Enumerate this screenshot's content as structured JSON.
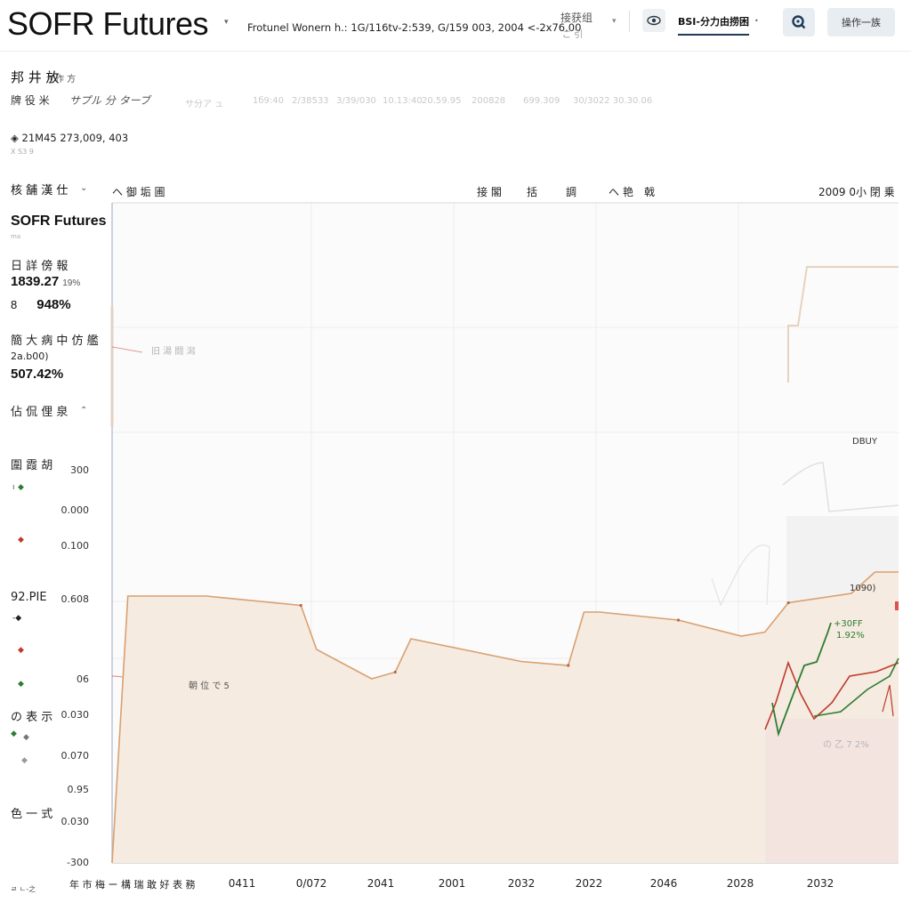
{
  "header": {
    "app_title": "SOFR Futures",
    "subtitle": "Frotunel Wonern h.: 1G/116tv-2:539, G/159 003, 2004 <-2x76.00",
    "menu_label": "接获组",
    "menu_sub": "ご 引",
    "tab_label": "BSI-分力由捞困",
    "action_label": "操作一族"
  },
  "section": {
    "title": "邦 井 放",
    "title_small": "サ作 方",
    "info_label": "牌 役 米",
    "info_value": "サプル 分 ターブ",
    "faded_items": [
      "サ分ア ュ",
      "1б9:40",
      "2/38533",
      "3/39/030",
      "10.13:40",
      "20.59.95",
      "200828",
      "699.309",
      "30/3022 30.30.06"
    ],
    "meta_line": "21M45 273,009, 403",
    "meta_sub": "X S3 9"
  },
  "sidebar": {
    "heading": "核 舗 漢 仕",
    "ticker": "SOFR Futures",
    "ticker_sub": "ma",
    "stat1_label": "日 詳 傍 報",
    "stat1_value": "1839.27",
    "stat1_small": "19%",
    "stat2_prefix": "8",
    "stat2_value": "948%",
    "stat3_label": "簡 大 病 中 仿 艦",
    "stat3_sub": "2a.b00)",
    "stat3_value": "507.42%",
    "collapse_label": "佔 侃 俚 泉",
    "legend_a": "圍 霞 胡",
    "legend_b": "92.PIE",
    "legend_c": "の 表 示",
    "legend_d": "色 一 式",
    "left_y": [
      "300",
      "0.000",
      "0.100",
      "0.608",
      "06",
      "0.030",
      "0.070",
      "0.95",
      "0.030",
      "-300"
    ],
    "footer_mark": "ㄹ ㄴ-之",
    "footer_text": "年 市 梅 ー 構 瑞 敢 好 表 務"
  },
  "chart_head": {
    "col1": "ヘ 御 垢 圃",
    "col2": "接 閣",
    "col3": "括",
    "col4": "調",
    "col5": "ヘ 艳",
    "col6": "戟",
    "col7": "2009 0小 閉 乗"
  },
  "chart_data": {
    "type": "line",
    "x_ticks": [
      "0411",
      "0/072",
      "2041",
      "2001",
      "2032",
      "2022",
      "2046",
      "2028",
      "2032"
    ],
    "series": [
      {
        "values": [
          [
            0.0,
            -10
          ],
          [
            0.02,
            190
          ],
          [
            0.12,
            190
          ],
          [
            0.24,
            183
          ],
          [
            0.26,
            150
          ],
          [
            0.33,
            128
          ],
          [
            0.36,
            133
          ],
          [
            0.38,
            158
          ],
          [
            0.52,
            141
          ],
          [
            0.58,
            138
          ],
          [
            0.6,
            178
          ],
          [
            0.62,
            178
          ],
          [
            0.72,
            172
          ],
          [
            0.8,
            160
          ],
          [
            0.83,
            163
          ],
          [
            0.86,
            185
          ],
          [
            0.94,
            192
          ],
          [
            0.97,
            208
          ],
          [
            1.0,
            208
          ]
        ]
      }
    ],
    "annotations": {
      "box1": "1090)",
      "box2": "DBUY",
      "green_label": "+30FF",
      "green_value": "1.92%",
      "faint1": "旧 湯 闘 潟",
      "faint2": "朝 位 で 5",
      "faint3": "の 乙 7 2%"
    },
    "colors": {
      "area": "#f5ebe0",
      "line": "#d9a070",
      "green": "#2e7d32",
      "red": "#c0392b",
      "pink_area": "#f2e0e0"
    }
  }
}
